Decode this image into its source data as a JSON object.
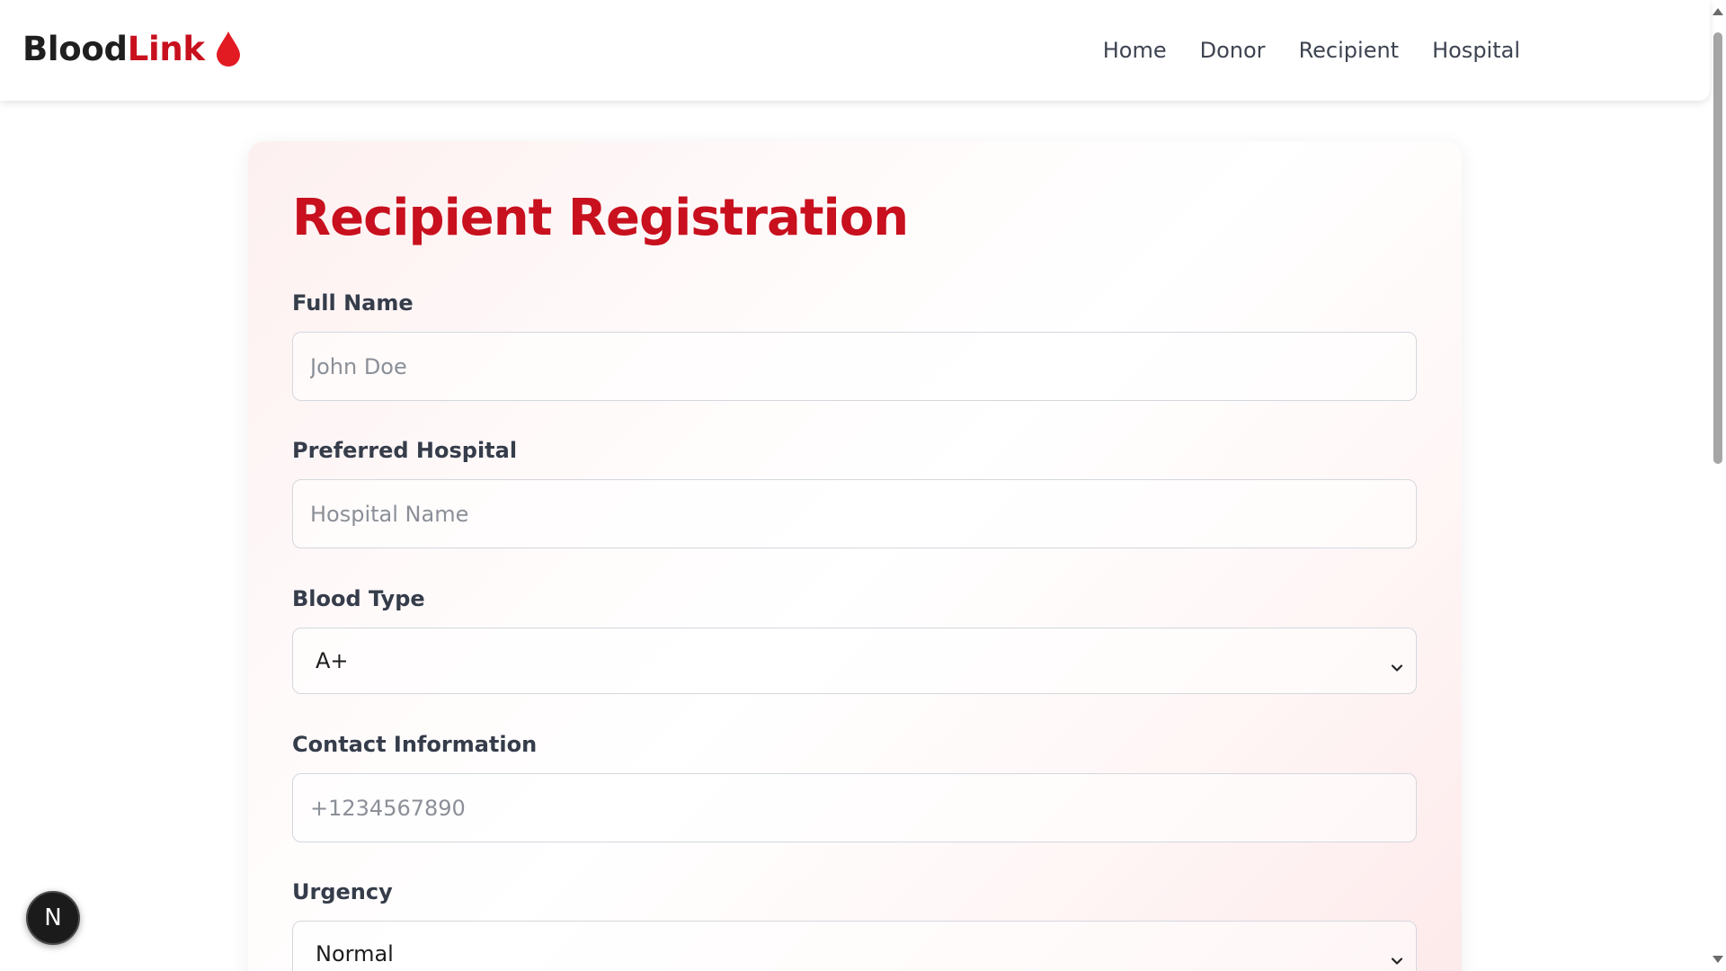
{
  "brand": {
    "part1": "Blood",
    "part2": "Link",
    "icon": "blood-drop-icon",
    "colors": {
      "dark": "#1f1f1f",
      "accent": "#c8101e"
    }
  },
  "nav": {
    "items": [
      {
        "label": "Home"
      },
      {
        "label": "Donor"
      },
      {
        "label": "Recipient"
      },
      {
        "label": "Hospital"
      }
    ]
  },
  "form": {
    "title": "Recipient Registration",
    "fields": {
      "full_name": {
        "label": "Full Name",
        "placeholder": "John Doe",
        "value": ""
      },
      "hospital": {
        "label": "Preferred Hospital",
        "placeholder": "Hospital Name",
        "value": ""
      },
      "blood_type": {
        "label": "Blood Type",
        "selected": "A+"
      },
      "contact": {
        "label": "Contact Information",
        "placeholder": "+1234567890",
        "value": ""
      },
      "urgency": {
        "label": "Urgency",
        "selected": "Normal"
      }
    }
  },
  "badge": {
    "label": "N"
  }
}
